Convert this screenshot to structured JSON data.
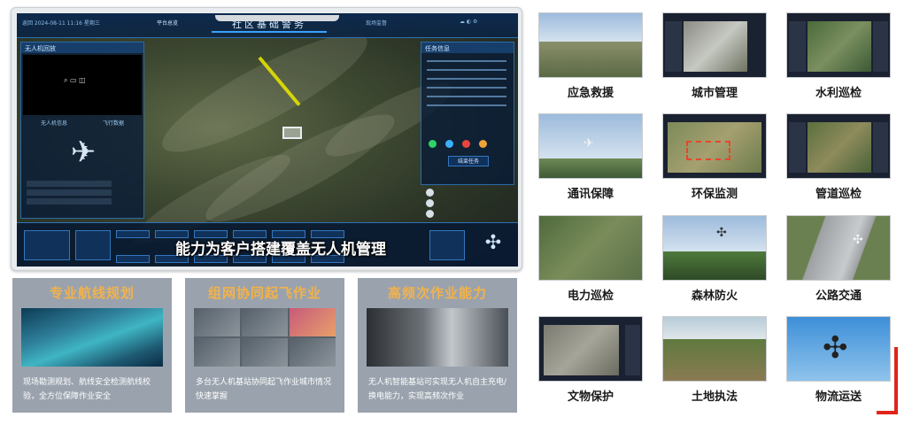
{
  "monitor": {
    "screen_title": "社区基础警务",
    "top_left_text": "返回  2024-08-11 11:16 星期三",
    "top_tab": "平台总览",
    "top_right_text": "现场监督",
    "left_panel_title": "无人机回放",
    "left_tabs": [
      "无人机信息",
      "飞行数据"
    ],
    "right_panel_title": "任务信息",
    "right_button": "结束任务",
    "subtitle": "能力为客户搭建覆盖无人机管理"
  },
  "features": [
    {
      "title": "专业航线规划",
      "desc": "现场勘测规划、航线安全检测航线校验，全方位保障作业安全"
    },
    {
      "title": "组网协同起飞作业",
      "desc": "多台无人机基站协同起飞作业城市情况快速掌握"
    },
    {
      "title": "高频次作业能力",
      "desc": "无人机智能基站可实现无人机自主充电/换电能力，实现高频次作业"
    }
  ],
  "scenarios": [
    {
      "label": "应急救援"
    },
    {
      "label": "城市管理"
    },
    {
      "label": "水利巡检"
    },
    {
      "label": "通讯保障"
    },
    {
      "label": "环保监测"
    },
    {
      "label": "管道巡检"
    },
    {
      "label": "电力巡检"
    },
    {
      "label": "森林防火"
    },
    {
      "label": "公路交通"
    },
    {
      "label": "文物保护"
    },
    {
      "label": "土地执法"
    },
    {
      "label": "物流运送"
    }
  ],
  "colors": {
    "feature_title": "#f3b24a",
    "feature_bg": "#9aa3ad",
    "accent_red": "#e0241a",
    "hud_blue": "#2b6aa8"
  }
}
